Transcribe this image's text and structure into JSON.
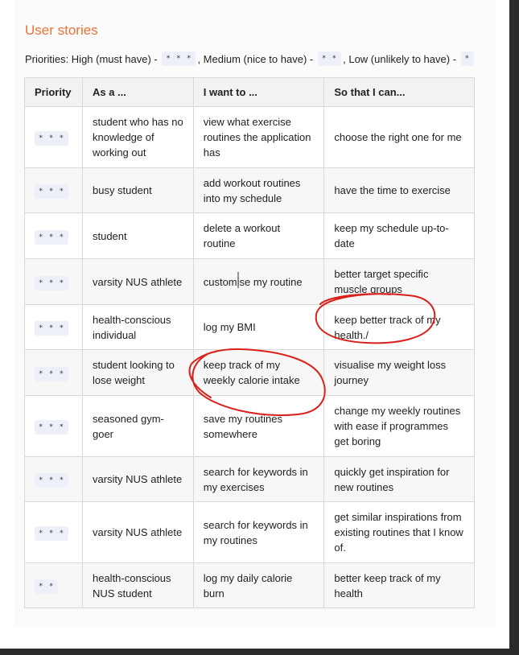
{
  "heading": "User stories",
  "priorities_line": {
    "prefix": "Priorities: High (must have) -",
    "high_badge": "* * *",
    "medium_text": ", Medium (nice to have) -",
    "medium_badge": "* *",
    "low_text": ", Low (unlikely to have) -",
    "low_badge": "*"
  },
  "table": {
    "headers": [
      "Priority",
      "As a ...",
      "I want to ...",
      "So that I can..."
    ],
    "rows": [
      {
        "priority": "* * *",
        "as_a": "student who has no knowledge of working out",
        "want": "view what exercise routines the application has",
        "so_that": "choose the right one for me"
      },
      {
        "priority": "* * *",
        "as_a": "busy student",
        "want": "add workout routines into my schedule",
        "so_that": "have the time to exercise"
      },
      {
        "priority": "* * *",
        "as_a": "student",
        "want": "delete a workout routine",
        "so_that": "keep my schedule up-to-date"
      },
      {
        "priority": "* * *",
        "as_a": "varsity NUS athlete",
        "want": "customise my routine",
        "so_that": "better target specific muscle groups"
      },
      {
        "priority": "* * *",
        "as_a": "health-conscious individual",
        "want": "log my BMI",
        "so_that": "keep better track of my health./"
      },
      {
        "priority": "* * *",
        "as_a": "student looking to lose weight",
        "want": "keep track of my weekly calorie intake",
        "so_that": "visualise my weight loss journey"
      },
      {
        "priority": "* * *",
        "as_a": "seasoned gym-goer",
        "want": "save my routines somewhere",
        "so_that": "change my weekly routines with ease if programmes get boring"
      },
      {
        "priority": "* * *",
        "as_a": "varsity NUS athlete",
        "want": "search for keywords in my exercises",
        "so_that": "quickly get inspiration for new routines"
      },
      {
        "priority": "* * *",
        "as_a": "varsity NUS athlete",
        "want": "search for keywords in my routines",
        "so_that": "get similar inspirations from existing routines that I know of."
      },
      {
        "priority": "* *",
        "as_a": "health-conscious NUS student",
        "want": "log my daily calorie burn",
        "so_that": "better keep track of my health"
      }
    ]
  },
  "annotation_color": "#d9201a"
}
